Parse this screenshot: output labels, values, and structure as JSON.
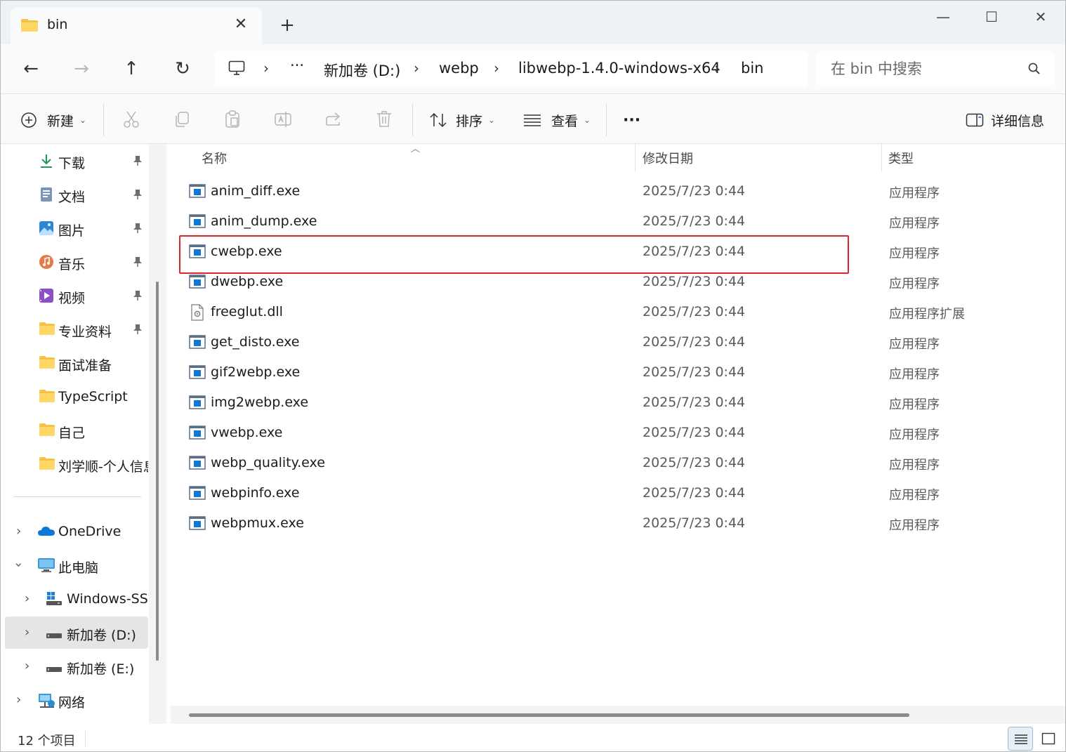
{
  "tab": {
    "title": "bin",
    "close": "✕",
    "new": "+"
  },
  "window_controls": {
    "minimize": "—",
    "maximize": "☐",
    "close": "✕"
  },
  "nav": {
    "back": "←",
    "forward": "→",
    "up": "↑",
    "refresh": "↻"
  },
  "breadcrumb": {
    "more": "···",
    "segments": [
      "新加卷 (D:)",
      "webp",
      "libwebp-1.4.0-windows-x64",
      "bin"
    ]
  },
  "search": {
    "placeholder": "在 bin 中搜索"
  },
  "toolbar": {
    "new_label": "新建",
    "sort_label": "排序",
    "view_label": "查看",
    "more_label": "···",
    "details_label": "详细信息"
  },
  "sidebar": {
    "quick_access": [
      {
        "label": "下载",
        "icon": "download-icon"
      },
      {
        "label": "文档",
        "icon": "document-icon"
      },
      {
        "label": "图片",
        "icon": "pictures-icon"
      },
      {
        "label": "音乐",
        "icon": "music-icon"
      },
      {
        "label": "视频",
        "icon": "video-icon"
      },
      {
        "label": "专业资料",
        "icon": "folder-icon"
      },
      {
        "label": "面试准备",
        "icon": "folder-icon"
      },
      {
        "label": "TypeScript",
        "icon": "folder-icon"
      },
      {
        "label": "自己",
        "icon": "folder-icon"
      },
      {
        "label": "刘学顺-个人信息",
        "icon": "folder-icon"
      }
    ],
    "tree": [
      {
        "label": "OneDrive",
        "icon": "onedrive-icon"
      },
      {
        "label": "此电脑",
        "icon": "computer-icon"
      },
      {
        "label": "Windows-SSD",
        "icon": "windows-drive-icon"
      },
      {
        "label": "新加卷 (D:)",
        "icon": "drive-icon"
      },
      {
        "label": "新加卷 (E:)",
        "icon": "drive-icon"
      },
      {
        "label": "网络",
        "icon": "network-icon"
      }
    ]
  },
  "columns": {
    "name": "名称",
    "modified": "修改日期",
    "type": "类型"
  },
  "files": [
    {
      "name": "anim_diff.exe",
      "date": "2025/7/23 0:44",
      "type": "应用程序",
      "kind": "exe"
    },
    {
      "name": "anim_dump.exe",
      "date": "2025/7/23 0:44",
      "type": "应用程序",
      "kind": "exe"
    },
    {
      "name": "cwebp.exe",
      "date": "2025/7/23 0:44",
      "type": "应用程序",
      "kind": "exe"
    },
    {
      "name": "dwebp.exe",
      "date": "2025/7/23 0:44",
      "type": "应用程序",
      "kind": "exe"
    },
    {
      "name": "freeglut.dll",
      "date": "2025/7/23 0:44",
      "type": "应用程序扩展",
      "kind": "dll"
    },
    {
      "name": "get_disto.exe",
      "date": "2025/7/23 0:44",
      "type": "应用程序",
      "kind": "exe"
    },
    {
      "name": "gif2webp.exe",
      "date": "2025/7/23 0:44",
      "type": "应用程序",
      "kind": "exe"
    },
    {
      "name": "img2webp.exe",
      "date": "2025/7/23 0:44",
      "type": "应用程序",
      "kind": "exe"
    },
    {
      "name": "vwebp.exe",
      "date": "2025/7/23 0:44",
      "type": "应用程序",
      "kind": "exe"
    },
    {
      "name": "webp_quality.exe",
      "date": "2025/7/23 0:44",
      "type": "应用程序",
      "kind": "exe"
    },
    {
      "name": "webpinfo.exe",
      "date": "2025/7/23 0:44",
      "type": "应用程序",
      "kind": "exe"
    },
    {
      "name": "webpmux.exe",
      "date": "2025/7/23 0:44",
      "type": "应用程序",
      "kind": "exe"
    }
  ],
  "status": {
    "count": "12 个项目"
  },
  "colors": {
    "highlight": "#e0262c",
    "accent": "#0067c0",
    "folder": "#f5c342"
  }
}
